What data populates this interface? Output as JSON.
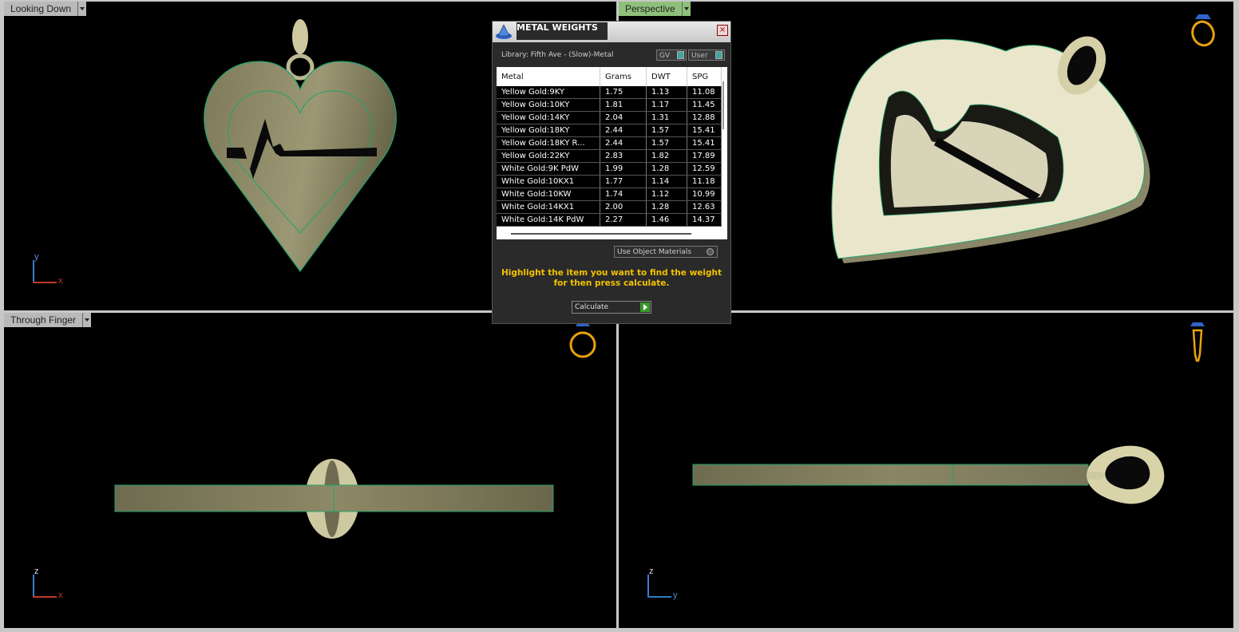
{
  "viewports": {
    "top_left": {
      "label": "Looking Down",
      "axis_v": "y",
      "axis_h": "x"
    },
    "top_right": {
      "label": "Perspective"
    },
    "bottom_left": {
      "label": "Through Finger",
      "axis_v": "z",
      "axis_h": "x"
    },
    "bottom_right": {
      "axis_v": "z",
      "axis_h": "y"
    }
  },
  "dialog": {
    "title": "METAL WEIGHTS",
    "close": "×",
    "library": "Library: Fifth Ave - (Slow)-Metal",
    "toggle_gv": "GV",
    "toggle_user": "User",
    "columns": [
      "Metal",
      "Grams",
      "DWT",
      "SPG"
    ],
    "rows": [
      [
        "Yellow Gold:9KY",
        "1.75",
        "1.13",
        "11.08"
      ],
      [
        "Yellow Gold:10KY",
        "1.81",
        "1.17",
        "11.45"
      ],
      [
        "Yellow Gold:14KY",
        "2.04",
        "1.31",
        "12.88"
      ],
      [
        "Yellow Gold:18KY",
        "2.44",
        "1.57",
        "15.41"
      ],
      [
        "Yellow Gold:18KY R...",
        "2.44",
        "1.57",
        "15.41"
      ],
      [
        "Yellow Gold:22KY",
        "2.83",
        "1.82",
        "17.89"
      ],
      [
        "White Gold:9K PdW",
        "1.99",
        "1.28",
        "12.59"
      ],
      [
        "White Gold:10KX1",
        "1.77",
        "1.14",
        "11.18"
      ],
      [
        "White Gold:10KW",
        "1.74",
        "1.12",
        "10.99"
      ],
      [
        "White Gold:14KX1",
        "2.00",
        "1.28",
        "12.63"
      ],
      [
        "White Gold:14K PdW",
        "2.27",
        "1.46",
        "14.37"
      ]
    ],
    "use_object_materials": "Use Object Materials",
    "hint": "Highlight the item you want to find the weight for then press calculate.",
    "calculate": "Calculate"
  },
  "colors": {
    "hint": "#f2c200",
    "metal": "#b9b48e",
    "outline": "#1fa36b",
    "label_active": "#8fc07a"
  }
}
